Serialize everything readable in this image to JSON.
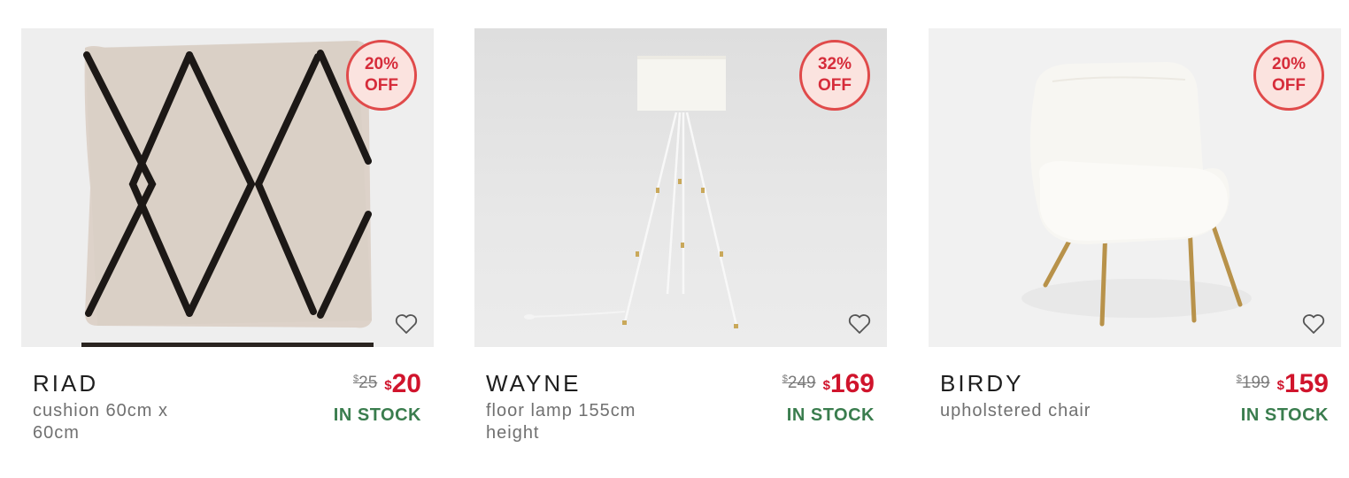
{
  "products": [
    {
      "name": "RIAD",
      "description": "cushion 60cm x 60cm",
      "old_price": "25",
      "new_price": "20",
      "currency": "$",
      "discount_line1": "20%",
      "discount_line2": "OFF",
      "stock": "IN STOCK",
      "image": "cushion-image"
    },
    {
      "name": "WAYNE",
      "description": "floor lamp 155cm height",
      "old_price": "249",
      "new_price": "169",
      "currency": "$",
      "discount_line1": "32%",
      "discount_line2": "OFF",
      "stock": "IN STOCK",
      "image": "floor-lamp-image"
    },
    {
      "name": "BIRDY",
      "description": "upholstered chair",
      "old_price": "199",
      "new_price": "159",
      "currency": "$",
      "discount_line1": "20%",
      "discount_line2": "OFF",
      "stock": "IN STOCK",
      "image": "chair-image"
    }
  ],
  "icons": {
    "favorite": "heart-outline-icon"
  },
  "colors": {
    "sale_red": "#d0142c",
    "badge_border": "#e04a4a",
    "badge_fill": "#fbe3df",
    "stock_green": "#3a7d4e"
  }
}
